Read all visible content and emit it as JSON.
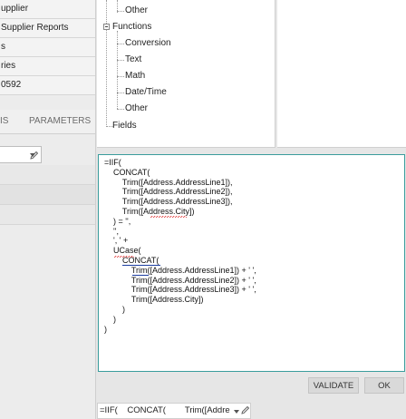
{
  "sidebar": {
    "items": [
      "upplier",
      "Supplier Reports",
      "s",
      "ries",
      "0592"
    ],
    "tabs": [
      "IS",
      "PARAMETERS"
    ]
  },
  "tree": {
    "nodes": [
      {
        "label": "Other"
      },
      {
        "label": "Functions"
      },
      {
        "label": "Conversion"
      },
      {
        "label": "Text"
      },
      {
        "label": "Math"
      },
      {
        "label": "Date/Time"
      },
      {
        "label": "Other"
      },
      {
        "label": "Fields"
      }
    ]
  },
  "editor": {
    "lines": [
      "=IIF(",
      "    CONCAT(",
      "        Trim([Address.AddressLine1]),",
      "        Trim([Address.AddressLine2]),",
      "        Trim([Address.AddressLine3]),",
      "        Trim([Address.City])",
      "    ) = '',",
      "    '',",
      "    ', ' +",
      "    UCase(",
      "        CONCAT(",
      "            Trim([Address.AddressLine1]) + ' ',",
      "            Trim([Address.AddressLine2]) + ' ',",
      "            Trim([Address.AddressLine3]) + ' ',",
      "            Trim([Address.City])",
      "        )",
      "    )",
      ")"
    ]
  },
  "buttons": {
    "validate": "VALIDATE",
    "ok": "OK"
  },
  "bottom": {
    "value": "=IIF(    CONCAT(        Trim([Addre"
  },
  "icons": {
    "edit": "pencil-icon",
    "dropdown": "chevron-down-icon"
  }
}
